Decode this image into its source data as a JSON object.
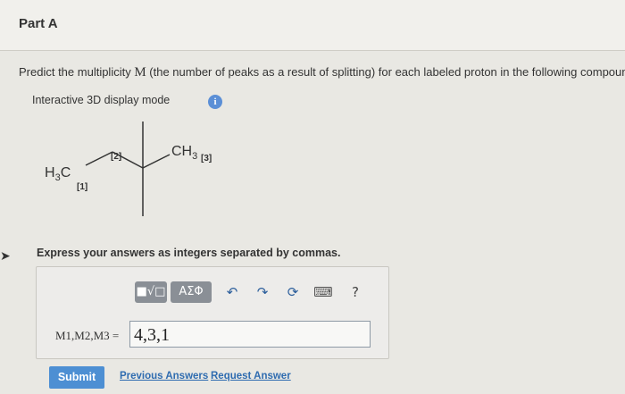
{
  "part_title": "Part A",
  "question": {
    "before": "Predict the multiplicity ",
    "symbol": "M",
    "after": " (the number of peaks as a result of splitting) for each labeled proton in the following compound."
  },
  "mode_label": "Interactive 3D display mode",
  "info_icon_glyph": "i",
  "molecule": {
    "left_group": "H3C",
    "label_1": "[1]",
    "label_2": "[2]",
    "right_group": "CH3",
    "label_3": "[3]"
  },
  "hint": "Express your answers as integers separated by commas.",
  "toolbar": {
    "template_glyph": "■√□",
    "greek_label": "ΑΣΦ",
    "undo_glyph": "↶",
    "redo_glyph": "↷",
    "reset_glyph": "⟳",
    "keyboard_glyph": "⌨",
    "help_glyph": "?"
  },
  "answer": {
    "label": "M1,M2,M3 =",
    "value": "4,3,1"
  },
  "buttons": {
    "submit": "Submit",
    "previous_answers": "Previous Answers",
    "request_answer": "Request Answer"
  },
  "colors": {
    "accent": "#4d8fd3",
    "link": "#2f6cb0"
  }
}
